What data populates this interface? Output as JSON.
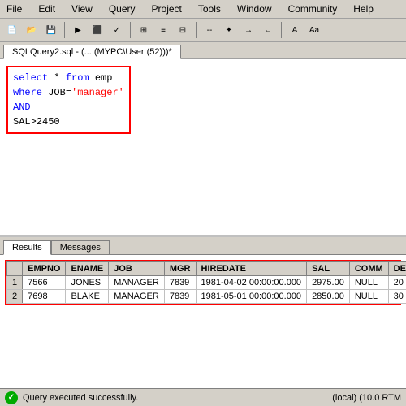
{
  "menubar": {
    "items": [
      "File",
      "Edit",
      "View",
      "Query",
      "Project",
      "Tools",
      "Window",
      "Community",
      "Help"
    ]
  },
  "tab": {
    "label": "SQLQuery2.sql - (... (MYPC\\User (52)))*"
  },
  "sql": {
    "line1": "select * from emp",
    "line2": "where JOB='manager'",
    "line3": "AND",
    "line4": "SAL>2450"
  },
  "results_tabs": {
    "results": "Results",
    "messages": "Messages"
  },
  "table": {
    "columns": [
      "",
      "EMPNO",
      "ENAME",
      "JOB",
      "MGR",
      "HIREDATE",
      "SAL",
      "COMM",
      "DEPTNO"
    ],
    "rows": [
      [
        "1",
        "7566",
        "JONES",
        "MANAGER",
        "7839",
        "1981-04-02 00:00:00.000",
        "2975.00",
        "NULL",
        "20"
      ],
      [
        "2",
        "7698",
        "BLAKE",
        "MANAGER",
        "7839",
        "1981-05-01 00:00:00.000",
        "2850.00",
        "NULL",
        "30"
      ]
    ]
  },
  "status": {
    "message": "Query executed successfully.",
    "server": "(local) (10.0 RTM"
  }
}
